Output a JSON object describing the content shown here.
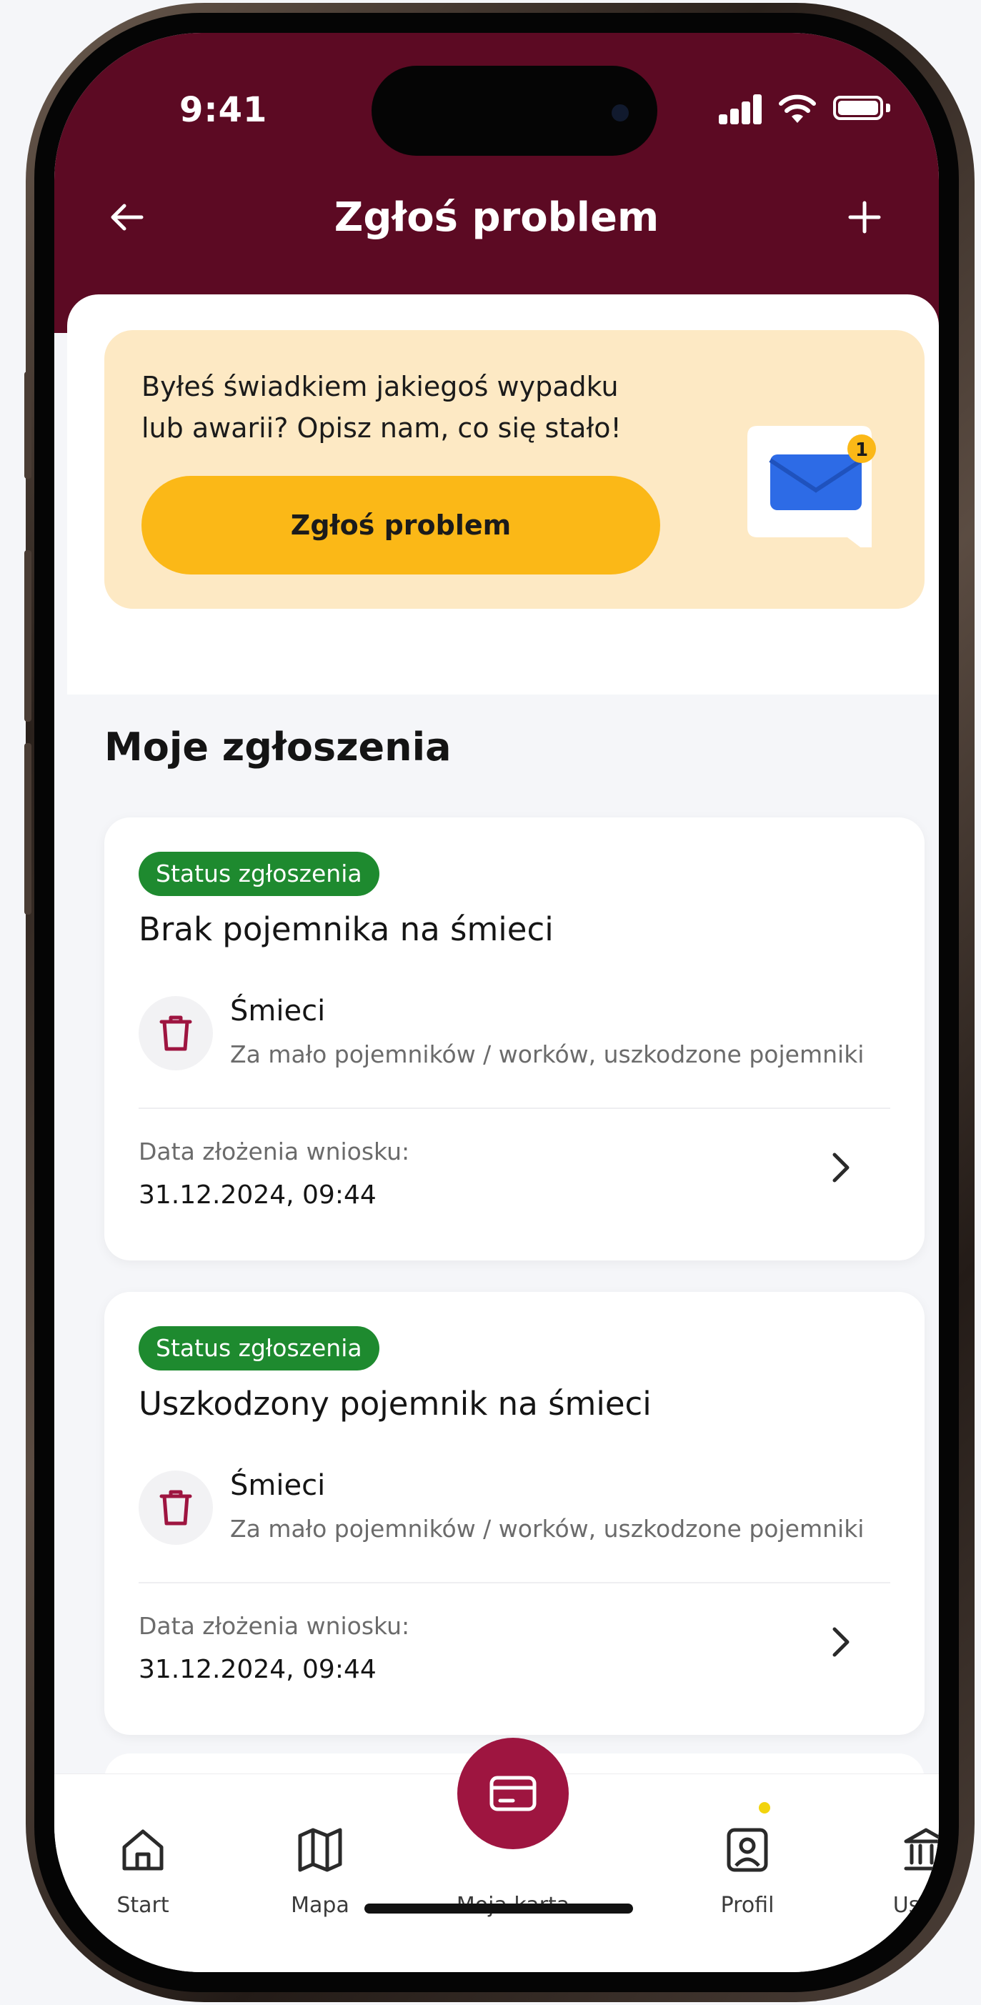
{
  "status_bar": {
    "time": "9:41"
  },
  "nav": {
    "back_icon": "arrow-left-icon",
    "title": "Zgłoś problem",
    "add_icon": "plus-icon"
  },
  "promo": {
    "line1": "Byłeś świadkiem jakiegoś wypadku",
    "line2": "lub awarii? Opisz nam, co się stało!",
    "button_label": "Zgłoś problem",
    "art_icon": "envelope-icon",
    "notification_count": "1"
  },
  "section": {
    "title": "Moje zgłoszenia"
  },
  "reports": [
    {
      "status": "Status zgłoszenia",
      "title": "Brak pojemnika na śmieci",
      "category": "Śmieci",
      "description": "Za mało pojemników / worków, uszkodzone pojemniki",
      "date_label": "Data złożenia wniosku:",
      "date": "31.12.2024, 09:44"
    },
    {
      "status": "Status zgłoszenia",
      "title": "Uszkodzony pojemnik na śmieci",
      "category": "Śmieci",
      "description": "Za mało pojemników / worków, uszkodzone pojemniki",
      "date_label": "Data złożenia wniosku:",
      "date": "31.12.2024, 09:44"
    }
  ],
  "tabbar": {
    "items": [
      {
        "label": "Start",
        "icon": "home-icon"
      },
      {
        "label": "Mapa",
        "icon": "map-icon"
      },
      {
        "label": "Moja karta",
        "icon": "card-icon"
      },
      {
        "label": "Profil",
        "icon": "profile-icon"
      },
      {
        "label": "Usługi",
        "icon": "institution-icon"
      }
    ]
  },
  "colors": {
    "brand": "#5c0a23",
    "accent": "#9e1540",
    "cta": "#fbb817",
    "promo_bg": "#fde9c4",
    "status_green": "#1e8a2f"
  }
}
